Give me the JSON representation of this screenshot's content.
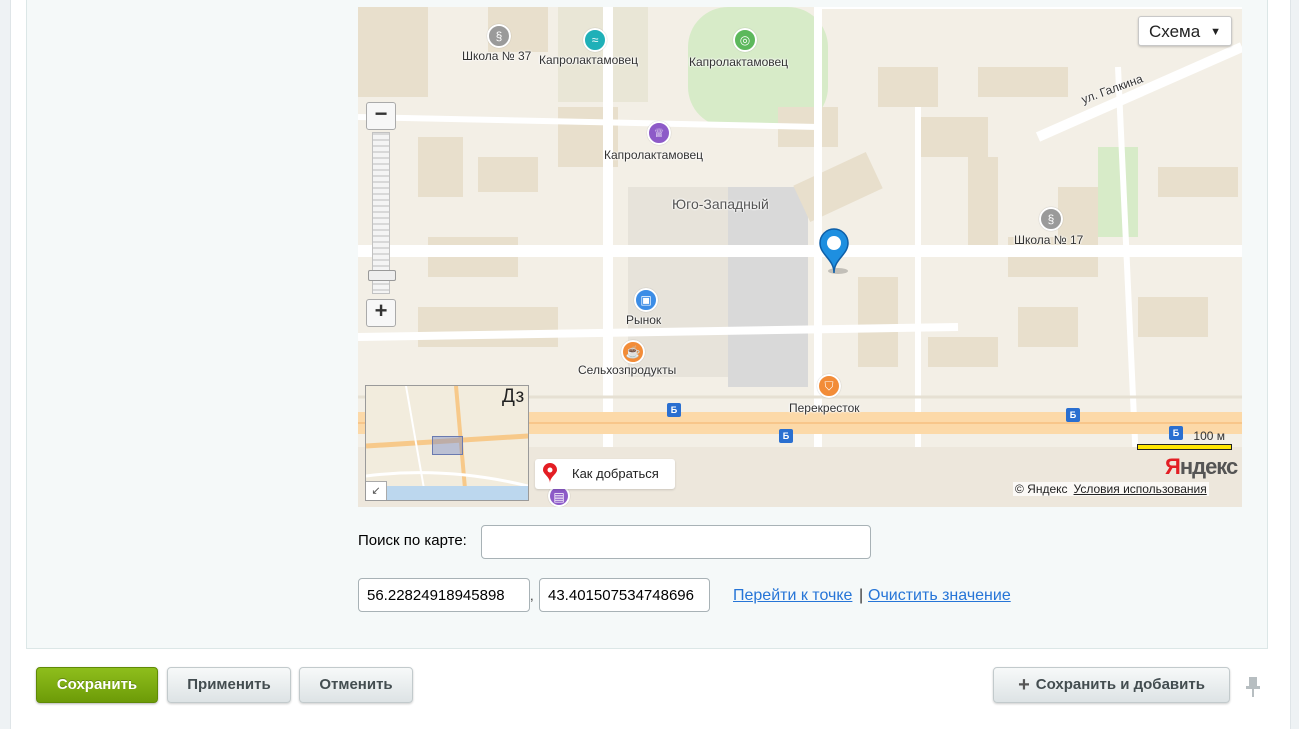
{
  "map": {
    "type_selector": "Схема",
    "labels": {
      "school37": "Школа № 37",
      "kaprolaktamovets_pool": "Капролактамовец",
      "kaprolaktamovets_stadium": "Капролактамовец",
      "kaprolaktamovets_trophy": "Капролактамовец",
      "district": "Юго-Западный",
      "school17": "Школа № 17",
      "street": "ул. Галкина",
      "market": "Рынок",
      "selkhoz": "Сельхозпродукты",
      "perekrestok": "Перекресток"
    },
    "minimap_label": "Дз",
    "route_button": "Как добраться",
    "scale_label": "100 м",
    "logo": "Яндекс",
    "copyright": "© Яндекс",
    "terms_link": "Условия использования"
  },
  "form": {
    "search_label": "Поиск по карте:",
    "search_value": "",
    "latitude": "56.22824918945898",
    "comma": ",",
    "longitude": "43.401507534748696",
    "goto_link": "Перейти к точке",
    "separator": "|",
    "clear_link": "Очистить значение"
  },
  "buttons": {
    "save": "Сохранить",
    "apply": "Применить",
    "cancel": "Отменить",
    "save_add": "Сохранить и добавить"
  },
  "colors": {
    "accent_green": "#7aab10",
    "link_blue": "#2675d7",
    "map_marker": "#1e8fe0",
    "yandex_red": "#e31e24"
  }
}
